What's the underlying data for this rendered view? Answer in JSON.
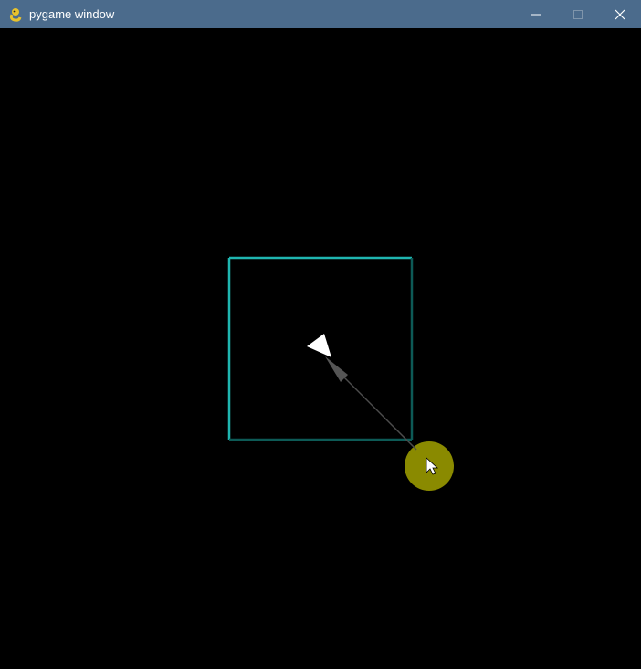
{
  "window": {
    "title": "pygame window",
    "icon": "pygame-snake-icon",
    "controls": [
      "minimize-icon",
      "maximize-icon",
      "close-icon"
    ]
  },
  "scene": {
    "background": "#000000",
    "box_color": "#1fb5b0",
    "agent_color": "#ffffff",
    "vector_color": "#555555",
    "target_color": "#8a8a00",
    "cursor_color": "#ffffff"
  }
}
